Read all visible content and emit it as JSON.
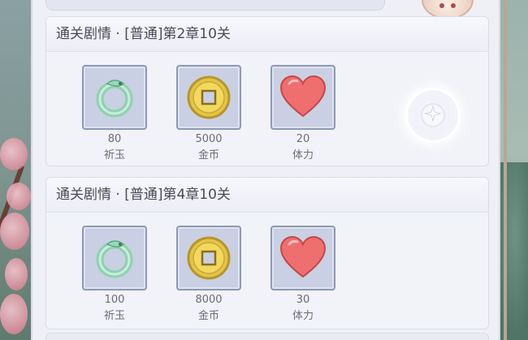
{
  "quests": [
    {
      "title": "通关剧情 · [普通]第2章10关",
      "rewards": [
        {
          "icon": "jade-icon",
          "amount": "80",
          "name": "祈玉"
        },
        {
          "icon": "gold-coin-icon",
          "amount": "5000",
          "name": "金币"
        },
        {
          "icon": "heart-icon",
          "amount": "20",
          "name": "体力"
        }
      ],
      "claimable": true
    },
    {
      "title": "通关剧情 · [普通]第4章10关",
      "rewards": [
        {
          "icon": "jade-icon",
          "amount": "100",
          "name": "祈玉"
        },
        {
          "icon": "gold-coin-icon",
          "amount": "8000",
          "name": "金币"
        },
        {
          "icon": "heart-icon",
          "amount": "30",
          "name": "体力"
        }
      ],
      "claimable": false
    }
  ],
  "colors": {
    "panel": "#eef0f6",
    "reward_box": "#c9d0e3",
    "reward_border": "#8e99b4",
    "heart": "#ef6e6e",
    "coin": "#e3c545",
    "jade": "#8fd1b0"
  }
}
